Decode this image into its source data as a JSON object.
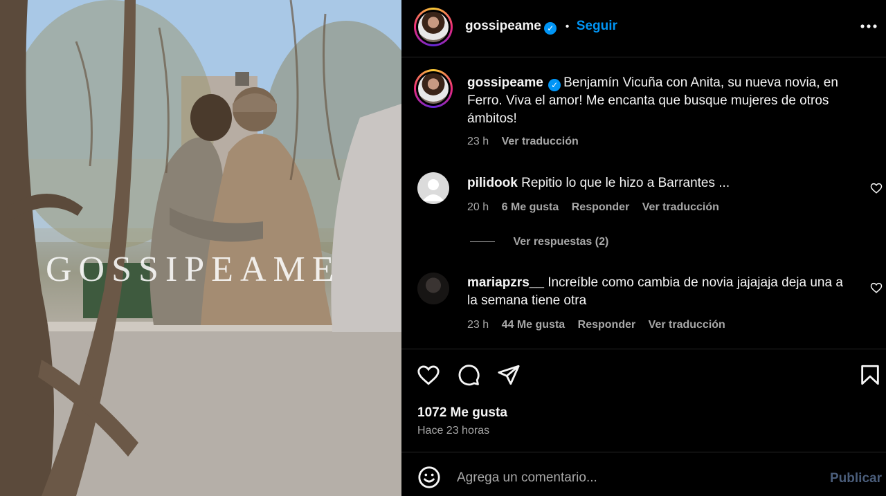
{
  "photo": {
    "watermark": "GOSSIPEAME"
  },
  "header": {
    "username": "gossipeame",
    "separator": "•",
    "follow_label": "Seguir",
    "more_icon": "more-horizontal-icon"
  },
  "caption": {
    "username": "gossipeame",
    "text": "Benjamín Vicuña con Anita, su nueva novia, en Ferro. Viva el amor! Me encanta que busque mujeres de otros ámbitos!",
    "time": "23 h",
    "translate": "Ver traducción"
  },
  "comments": [
    {
      "username": "pilidook",
      "text": "Repitio lo que le hizo a Barrantes ...",
      "time": "20 h",
      "likes": "6 Me gusta",
      "reply": "Responder",
      "translate": "Ver traducción",
      "view_replies": "Ver respuestas (2)"
    },
    {
      "username": "mariapzrs__",
      "text": "Increíble como cambia de novia jajajaja deja una a la semana tiene otra",
      "time": "23 h",
      "likes": "44 Me gusta",
      "reply": "Responder",
      "translate": "Ver traducción"
    }
  ],
  "actions": {
    "like_icon": "heart-icon",
    "comment_icon": "comment-icon",
    "share_icon": "send-icon",
    "save_icon": "bookmark-icon"
  },
  "stats": {
    "likes": "1072 Me gusta",
    "time_ago": "Hace 23 horas"
  },
  "comment_box": {
    "placeholder": "Agrega un comentario...",
    "publish_label": "Publicar",
    "emoji_icon": "emoji-icon"
  },
  "colors": {
    "accent": "#0095f6",
    "publish_disabled": "#4a5d7a",
    "divider": "#262626",
    "secondary_text": "#a8a8a8"
  }
}
